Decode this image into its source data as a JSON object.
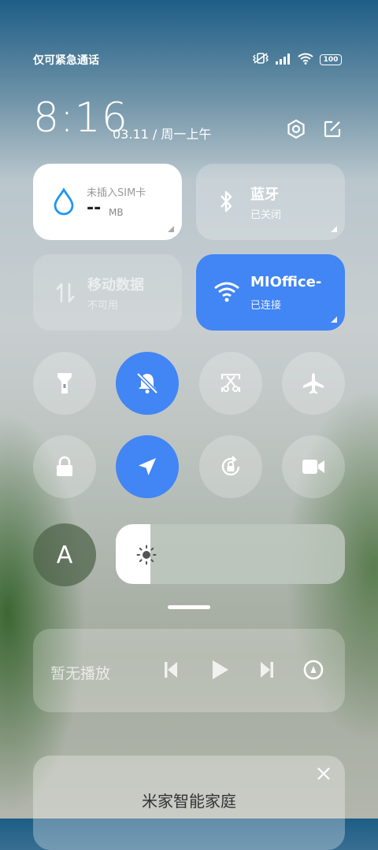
{
  "status_bar": {
    "carrier_text": "仅可紧急通话",
    "battery": "100"
  },
  "header": {
    "time": "8:16",
    "date": "03.11 / 周一上午"
  },
  "tiles": {
    "data_usage": {
      "label": "未插入SIM卡",
      "value": "--",
      "unit": "MB"
    },
    "bluetooth": {
      "title": "蓝牙",
      "status": "已关闭"
    },
    "mobile_data": {
      "title": "移动数据",
      "status": "不可用"
    },
    "wifi": {
      "title": "MIOffice-",
      "status": "已连接",
      "accent": "#4285f4"
    }
  },
  "toggles": [
    {
      "name": "flashlight",
      "icon": "flashlight-icon",
      "active": false
    },
    {
      "name": "silent",
      "icon": "bell-off-icon",
      "active": true
    },
    {
      "name": "screenshot",
      "icon": "scissors-icon",
      "active": false
    },
    {
      "name": "airplane",
      "icon": "airplane-icon",
      "active": false
    },
    {
      "name": "lock",
      "icon": "lock-icon",
      "active": false
    },
    {
      "name": "location",
      "icon": "location-arrow-icon",
      "active": true
    },
    {
      "name": "rotation-lock",
      "icon": "rotate-lock-icon",
      "active": false
    },
    {
      "name": "screen-record",
      "icon": "video-camera-icon",
      "active": false
    }
  ],
  "auto_brightness": {
    "label": "A"
  },
  "brightness": {
    "level": 0.15
  },
  "media": {
    "status": "暂无播放"
  },
  "smart_home": {
    "title": "米家智能家庭"
  }
}
